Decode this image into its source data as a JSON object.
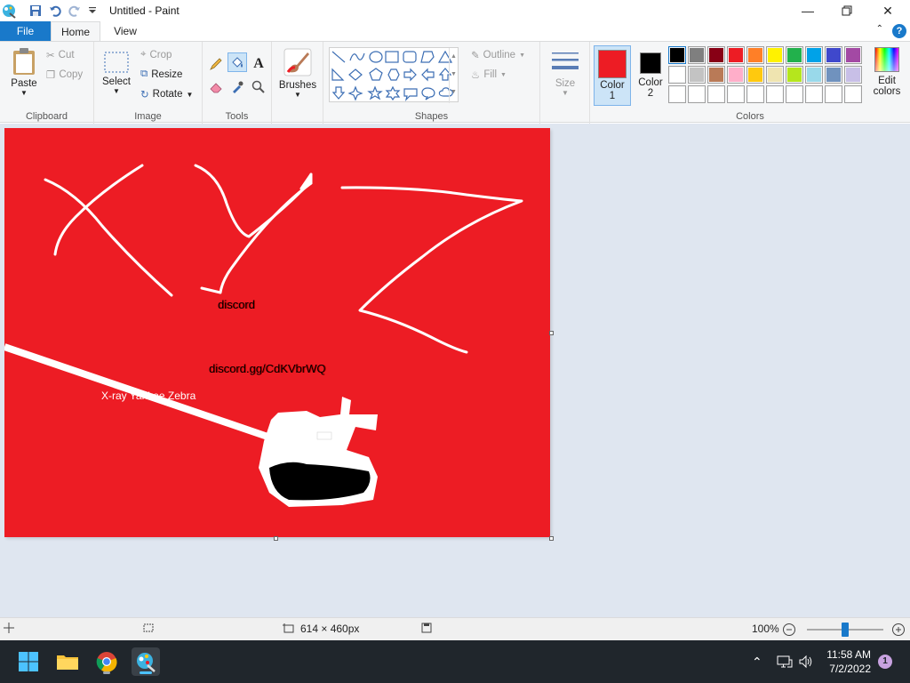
{
  "window": {
    "title": "Untitled - Paint",
    "minimize_icon": "minimize-icon",
    "maximize_icon": "restore-icon",
    "close_icon": "close-icon"
  },
  "quick_access": {
    "save_icon": "save-icon",
    "undo_icon": "undo-icon",
    "redo_icon": "redo-icon",
    "customize_icon": "chevron-down-icon"
  },
  "tabs": [
    {
      "label": "File"
    },
    {
      "label": "Home"
    },
    {
      "label": "View"
    }
  ],
  "ribbon": {
    "clipboard": {
      "label": "Clipboard",
      "paste": "Paste",
      "cut": "Cut",
      "copy": "Copy"
    },
    "image": {
      "label": "Image",
      "select": "Select",
      "crop": "Crop",
      "resize": "Resize",
      "rotate": "Rotate"
    },
    "tools": {
      "label": "Tools",
      "items": [
        "pencil-icon",
        "fill-icon",
        "text-icon",
        "eraser-icon",
        "color-picker-icon",
        "magnifier-icon"
      ]
    },
    "brushes": {
      "label": "Brushes"
    },
    "shapes": {
      "label": "Shapes",
      "outline": "Outline",
      "fill": "Fill",
      "items": [
        "line",
        "curve",
        "oval",
        "rectangle",
        "rounded-rectangle",
        "polygon",
        "triangle",
        "right-triangle",
        "diamond",
        "pentagon",
        "hexagon",
        "right-arrow",
        "left-arrow",
        "up-arrow",
        "down-arrow",
        "four-point-star",
        "five-point-star",
        "six-point-star",
        "rounded-callout",
        "oval-callout",
        "cloud-callout"
      ]
    },
    "size": {
      "label": "Size"
    },
    "colors": {
      "label": "Colors",
      "color1_label": "Color",
      "color1_num": "1",
      "color1": "#ed1c24",
      "color2_label": "Color",
      "color2_num": "2",
      "color2": "#000000",
      "edit_label_1": "Edit",
      "edit_label_2": "colors",
      "palette_row1": [
        "#000000",
        "#7f7f7f",
        "#880015",
        "#ed1c24",
        "#ff7f27",
        "#fff200",
        "#22b14c",
        "#00a2e8",
        "#3f48cc",
        "#a349a4"
      ],
      "palette_row2": [
        "#ffffff",
        "#c3c3c3",
        "#b97a57",
        "#ffaec9",
        "#ffc90e",
        "#efe4b0",
        "#b5e61d",
        "#99d9ea",
        "#7092be",
        "#c8bfe7"
      ],
      "palette_row3": [
        "#ffffff",
        "#ffffff",
        "#ffffff",
        "#ffffff",
        "#ffffff",
        "#ffffff",
        "#ffffff",
        "#ffffff",
        "#ffffff",
        "#ffffff"
      ]
    }
  },
  "canvas": {
    "background": "#ed1c24",
    "text_discord": "discord",
    "text_invite": "discord.gg/CdKVbrWQ",
    "text_xyz": "X-ray Yankee Zebra"
  },
  "status": {
    "dimensions": "614 × 460px",
    "zoom": "100%",
    "zoom_out_icon": "minus-icon",
    "zoom_in_icon": "plus-icon",
    "zoom_level": 0.5
  },
  "taskbar": {
    "time": "11:58 AM",
    "date": "7/2/2022",
    "notifications": "1"
  }
}
